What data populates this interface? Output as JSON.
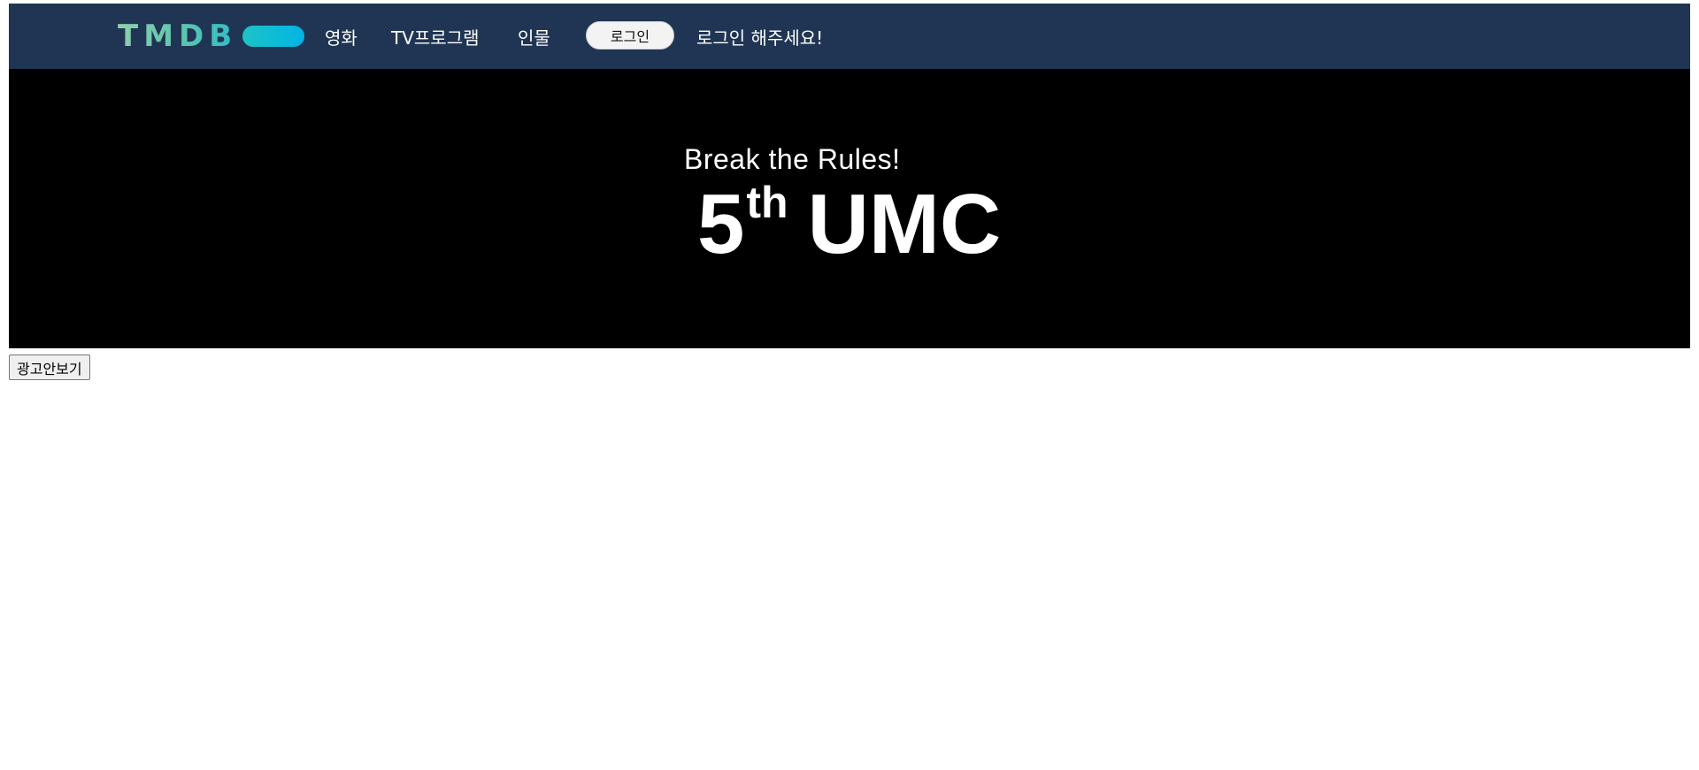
{
  "header": {
    "logo_text": "TMDB",
    "nav": {
      "movies": "영화",
      "tv": "TV프로그램",
      "people": "인물"
    },
    "login_button": "로그인",
    "login_message": "로그인 해주세요!"
  },
  "banner": {
    "subtitle": "Break the Rules!",
    "ordinal_number": "5",
    "ordinal_suffix": "th",
    "title": "UMC"
  },
  "ad_toggle_button": "광고안보기",
  "colors": {
    "navbar": "#1f3553",
    "banner": "#000000",
    "logo_gradient_start": "#8fcfae",
    "logo_gradient_end": "#01b4e4"
  }
}
